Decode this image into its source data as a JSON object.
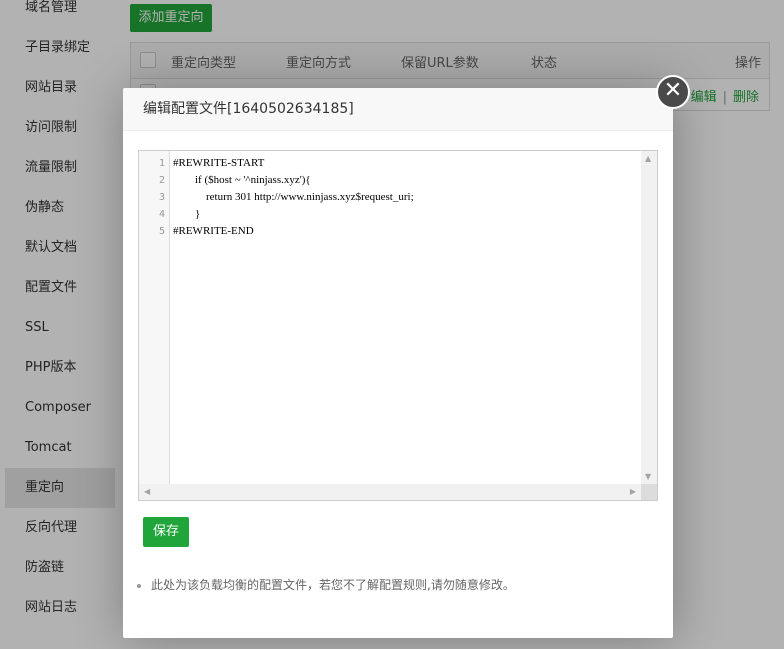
{
  "sidebar": {
    "items": [
      {
        "label": "域名管理"
      },
      {
        "label": "子目录绑定"
      },
      {
        "label": "网站目录"
      },
      {
        "label": "访问限制"
      },
      {
        "label": "流量限制"
      },
      {
        "label": "伪静态"
      },
      {
        "label": "默认文档"
      },
      {
        "label": "配置文件"
      },
      {
        "label": "SSL"
      },
      {
        "label": "PHP版本"
      },
      {
        "label": "Composer"
      },
      {
        "label": "Tomcat"
      },
      {
        "label": "重定向"
      },
      {
        "label": "反向代理"
      },
      {
        "label": "防盗链"
      },
      {
        "label": "网站日志"
      }
    ],
    "active_label": "重定向"
  },
  "main": {
    "add_button_label": "添加重定向",
    "table": {
      "headers": [
        "重定向类型",
        "重定向方式",
        "保留URL参数",
        "状态",
        "操作"
      ],
      "row_actions": {
        "edit": "编辑",
        "separator": "|",
        "delete": "删除"
      }
    }
  },
  "modal": {
    "title": "编辑配置文件[1640502634185]",
    "close_icon": "close-icon",
    "editor": {
      "line_numbers": [
        "1",
        "2",
        "3",
        "4",
        "5"
      ],
      "lines": [
        "#REWRITE-START",
        "        if ($host ~ '^ninjass.xyz'){",
        "            return 301 http://www.ninjass.xyz$request_uri;",
        "        }",
        "#REWRITE-END"
      ]
    },
    "save_label": "保存",
    "tip": "此处为该负载均衡的配置文件，若您不了解配置规则,请勿随意修改。"
  },
  "colors": {
    "accent": "#20a53a",
    "overlay": "rgba(0,0,0,0.3)",
    "close_button": "#4a4a4a"
  }
}
